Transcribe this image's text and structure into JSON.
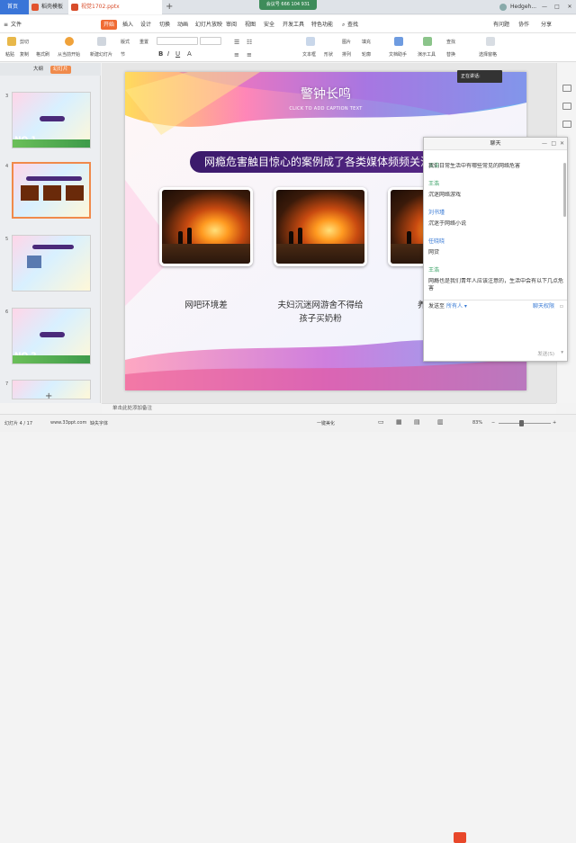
{
  "tabbar": {
    "home_tab": "首页",
    "doc_tab": "稻壳模板",
    "file_tab": "视觉1702.pptx",
    "new_tab": "+",
    "meeting_banner": "会议号 666 104 931",
    "user_name": "Hedgeh...",
    "min": "—",
    "max": "□",
    "close": "✕"
  },
  "menubar": {
    "file_menu": "文件",
    "items": [
      "开始",
      "插入",
      "设计",
      "切换",
      "动画",
      "幻灯片放映",
      "审阅",
      "视图",
      "安全",
      "开发工具",
      "特色功能"
    ],
    "search": "查找",
    "right_items": [
      "有问题",
      "协作",
      "分享"
    ]
  },
  "toolbar": {
    "paste": "粘贴",
    "cut": "剪切",
    "copy": "复制",
    "format_painter": "格式刷",
    "from_current": "从当前开始",
    "new_slide": "新建幻灯片",
    "layout": "版式",
    "section": "节",
    "reset": "重置",
    "text_box": "文本框",
    "shape": "形状",
    "arrange": "排列",
    "outline": "轮廓",
    "picture": "图片",
    "fill": "填充",
    "doc_assist": "文档助手",
    "presentation_tools": "演示工具",
    "find": "查找",
    "replace": "替换",
    "select_pane": "选择窗格"
  },
  "leftpanel": {
    "tab_outline": "大纲",
    "tab_slides": "幻灯片",
    "thumbs": [
      {
        "num": "3",
        "text": "NO.1"
      },
      {
        "num": "4",
        "text": ""
      },
      {
        "num": "5",
        "text": ""
      },
      {
        "num": "6",
        "text": "NO.2"
      },
      {
        "num": "7",
        "text": ""
      }
    ],
    "add_slide": "+"
  },
  "slide": {
    "title": "警钟长鸣",
    "subtitle": "CLICK TO ADD CAPTION TEXT",
    "banner": "网瘾危害触目惊心的案例成了各类媒体频频关注的",
    "captions": [
      "网吧环境差",
      "夫妇沉迷网游舍不得给\n孩子买奶粉",
      "养网恋女"
    ]
  },
  "notes": {
    "placeholder": "单击此处添加备注"
  },
  "statusbar": {
    "slide_counter": "幻灯片 4 / 17",
    "site": "www.33ppt.com",
    "font_missing": "缺失字体",
    "beautify": "一键美化",
    "zoom": "83%",
    "zoom_minus": "−",
    "zoom_plus": "+"
  },
  "tooltip": {
    "text": "正在讲话:"
  },
  "chat": {
    "title": "聊天",
    "messages": [
      {
        "name": "王浩",
        "text": "我们日常生活中有哪些常见的网络危害"
      },
      {
        "name": "王浩",
        "text": "沉迷网络游戏"
      },
      {
        "name": "刘书瑾",
        "text": "沉迷于网络小说"
      },
      {
        "name": "任晓晓",
        "text": "网贷"
      },
      {
        "name": "王浩",
        "text": "网瘾也是我们青年人应该注意的，生活中会有以下几点危害"
      }
    ],
    "send_to_label": "发送至",
    "send_to_value": "所有人",
    "permission": "聊天权限",
    "send_button": "发送(S)"
  }
}
